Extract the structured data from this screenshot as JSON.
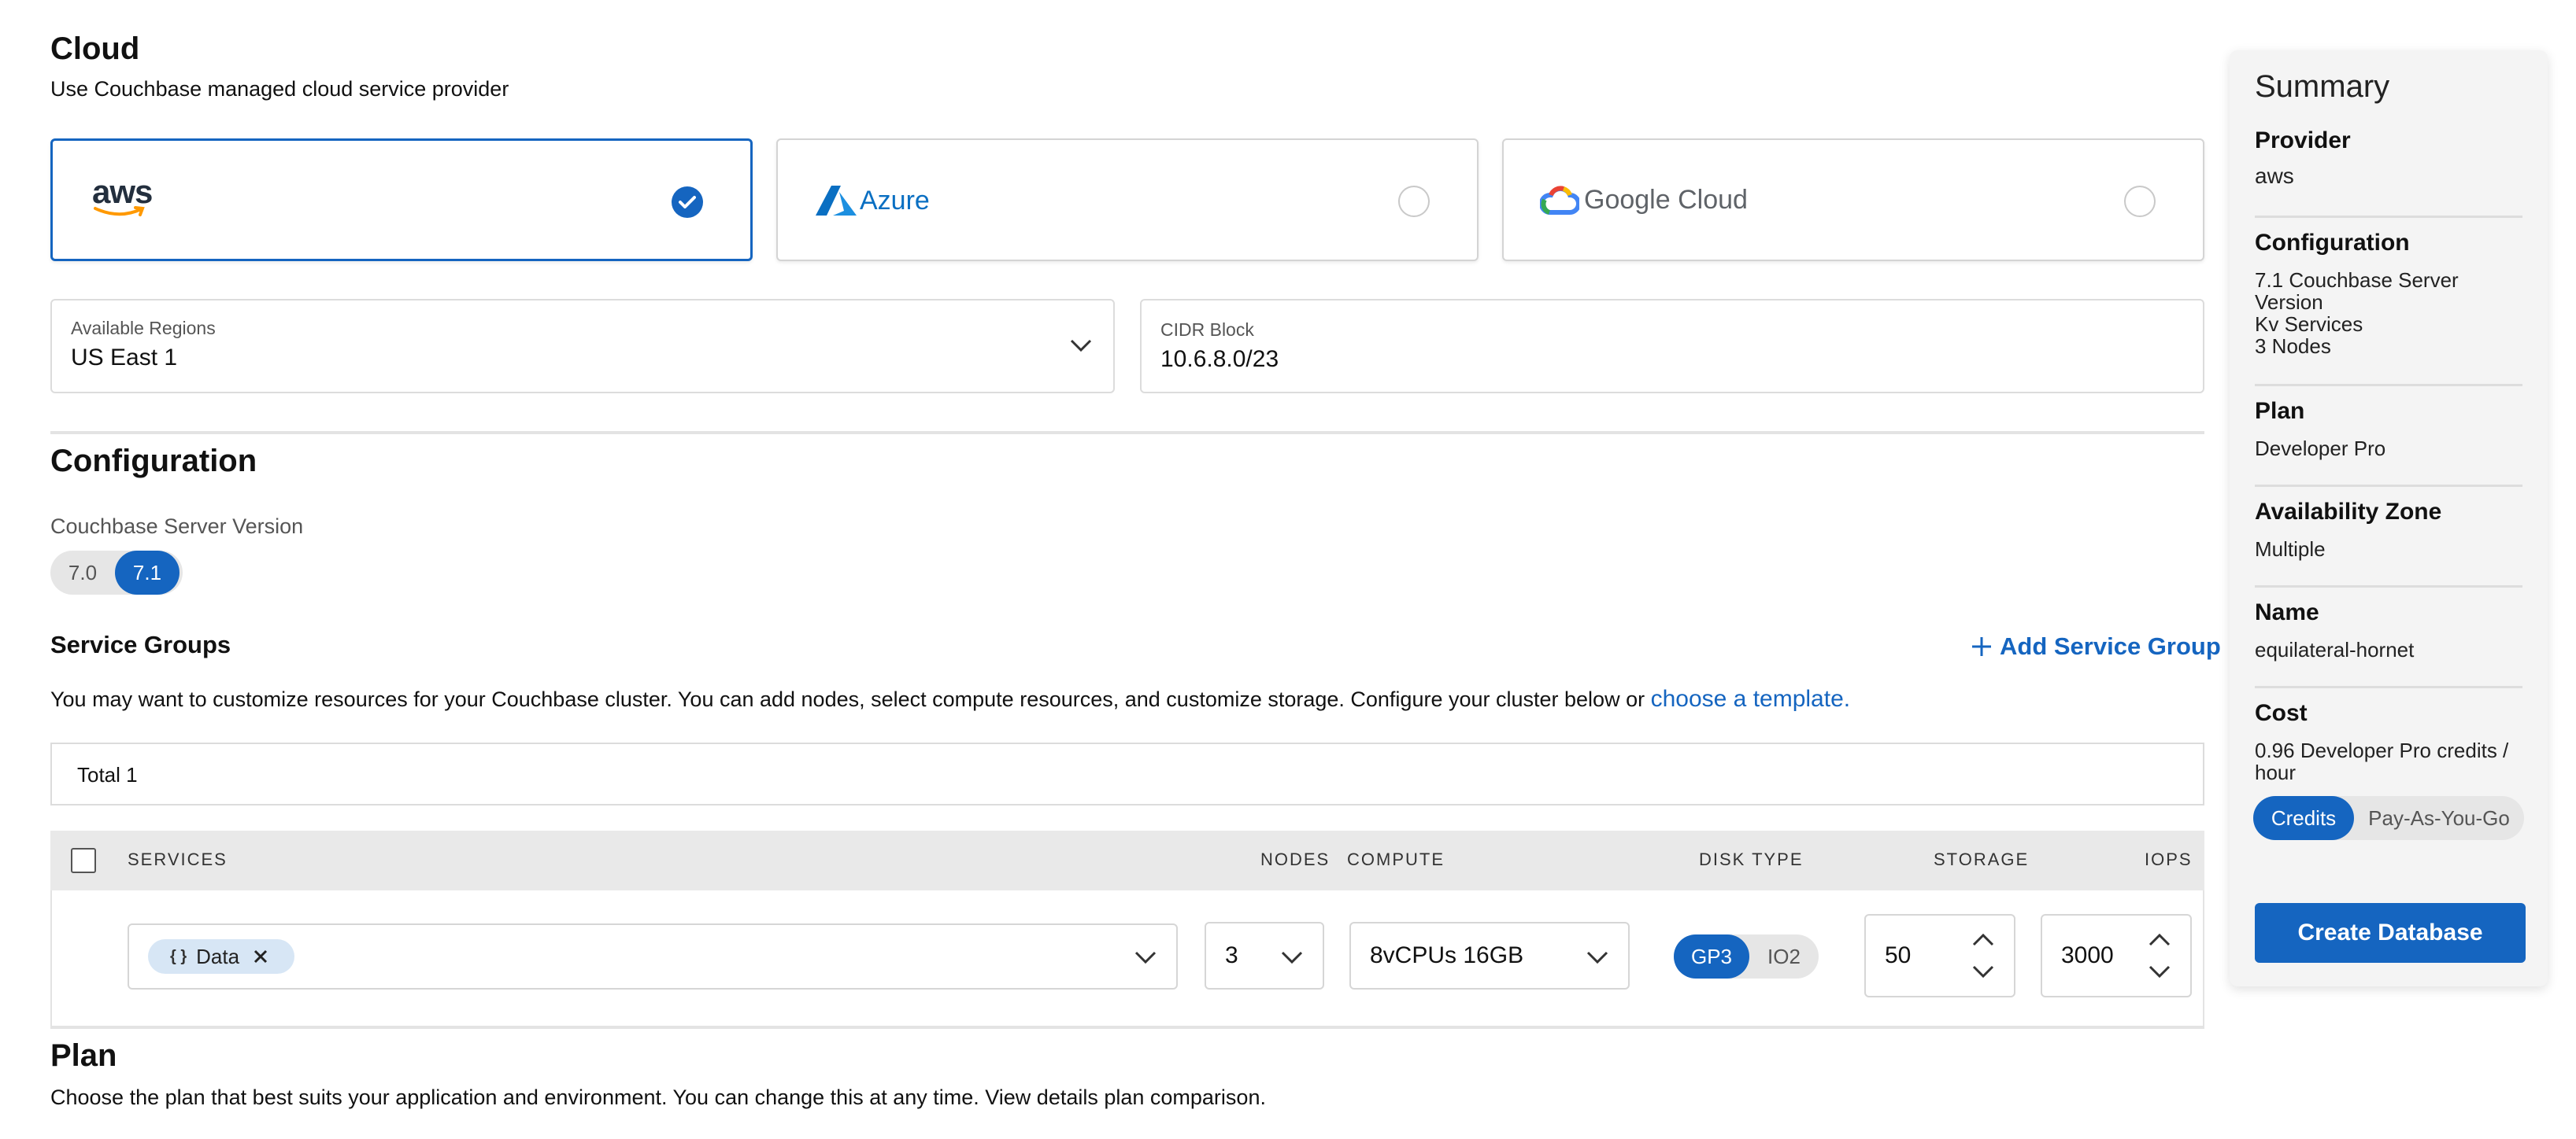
{
  "cloud": {
    "title": "Cloud",
    "subtitle": "Use Couchbase managed cloud service provider",
    "providers": [
      {
        "name": "aws",
        "selected": true
      },
      {
        "name": "Azure",
        "selected": false
      },
      {
        "name": "Google Cloud",
        "selected": false
      }
    ],
    "regions": {
      "label": "Available Regions",
      "value": "US East 1"
    },
    "cidr": {
      "label": "CIDR Block",
      "value": "10.6.8.0/23"
    }
  },
  "configuration": {
    "title": "Configuration",
    "version_label": "Couchbase Server Version",
    "versions": [
      "7.0",
      "7.1"
    ],
    "selected_version": "7.1"
  },
  "service_groups": {
    "title": "Service Groups",
    "add_label": "Add Service Group",
    "description": "You may want to customize resources for your Couchbase cluster. You can add nodes, select compute resources, and customize storage. Configure your cluster below or",
    "template_link": "choose a template.",
    "total": "Total 1",
    "columns": [
      "SERVICES",
      "NODES",
      "COMPUTE",
      "DISK TYPE",
      "STORAGE",
      "IOPS"
    ],
    "row": {
      "service_tag": "Data",
      "service_tag_icon": "{ }",
      "nodes": "3",
      "compute": "8vCPUs 16GB",
      "disk_types": [
        "GP3",
        "IO2"
      ],
      "selected_disk": "GP3",
      "storage": "50",
      "iops": "3000"
    }
  },
  "plan": {
    "title": "Plan",
    "description": "Choose the plan that best suits your application and environment. You can change this at any time. View details plan comparison."
  },
  "summary": {
    "title": "Summary",
    "provider_label": "Provider",
    "provider_value": "aws",
    "configuration_label": "Configuration",
    "configuration_lines": [
      "7.1 Couchbase Server",
      "Version",
      "Kv Services",
      "3 Nodes"
    ],
    "plan_label": "Plan",
    "plan_value": "Developer Pro",
    "az_label": "Availability Zone",
    "az_value": "Multiple",
    "name_label": "Name",
    "name_value": "equilateral-hornet",
    "cost_label": "Cost",
    "cost_lines": [
      "0.96 Developer Pro credits /",
      "hour"
    ],
    "billing_options": [
      "Credits",
      "Pay-As-You-Go"
    ],
    "selected_billing": "Credits",
    "create_button": "Create Database"
  },
  "colors": {
    "accent": "#1565c0",
    "link": "#1565c0"
  }
}
